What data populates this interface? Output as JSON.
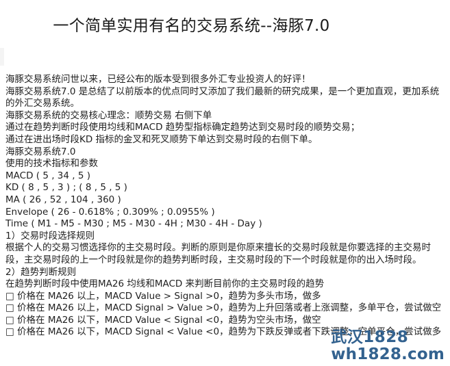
{
  "document": {
    "title": "一个简单实用有名的交易系统--海豚7.0",
    "paragraphs": [
      "海豚交易系统问世以来，已经公布的版本受到很多外汇专业投资人的好评！",
      "海豚交易系统7.0 是总结了以前版本的优点同时又添加了我们最新的研究成果，是一个更加直观，更加系统的外汇交易系统。",
      "海豚交易系统的交易核心理念：顺势交易 右侧下单",
      "通过在趋势判断时段使用均线和MACD 趋势型指标确定趋势达到交易时段的顺势交易；",
      "通过在进出场时段KD 指标的金叉和死叉顺势下单达到交易时段的右侧下单。",
      "海豚交易系统7.0",
      "使用的技术指标和参数",
      "MACD ( 5 , 34 , 5 )",
      "KD ( 8 , 5 , 3 ) ; ( 8 , 5 , 5 )",
      "MA ( 26 , 52 , 104 , 360 )",
      "Envelope ( 26 - 0.618% ; 0.309% ; 0.0955% )",
      "Time ( M1 - M5 - M30 ; M5 - M30 - 4H ; M30 - 4H - Day )",
      "1）交易时段选择规则",
      "根据个人的交易习惯选择你的主交易时段。判断的原则是你原来擅长的交易时段就是你要选择的主交易时段，主交易时段的上一个时段就是你的趋势判断时段，主交易时段的下一个时段就是你的出入场时段。",
      "2）趋势判断规则",
      "在趋势判断时段中使用MA26 均线和MACD 来判断目前你的主交易时段的趋势",
      "□ 价格在 MA26 以上，MACD Value > Signal >0，趋势为多头市场，做多",
      "□ 价格在 MA26 以上，MACD Signal > Value >0，趋势为上升回落或者上涨调整，多单平仓，尝试做空",
      "□ 价格在 MA26 以下，MACD Value < Signal <0，趋势为空头市场，做空",
      "□ 价格在 MA26 以下，MACD Signal < Value <0，趋势为下跌反弹或者下跌调整，空单平仓，尝试做多"
    ]
  },
  "watermark": {
    "line1": "武汉1828",
    "line2": "wh1828.com",
    "color": "#33628f"
  }
}
